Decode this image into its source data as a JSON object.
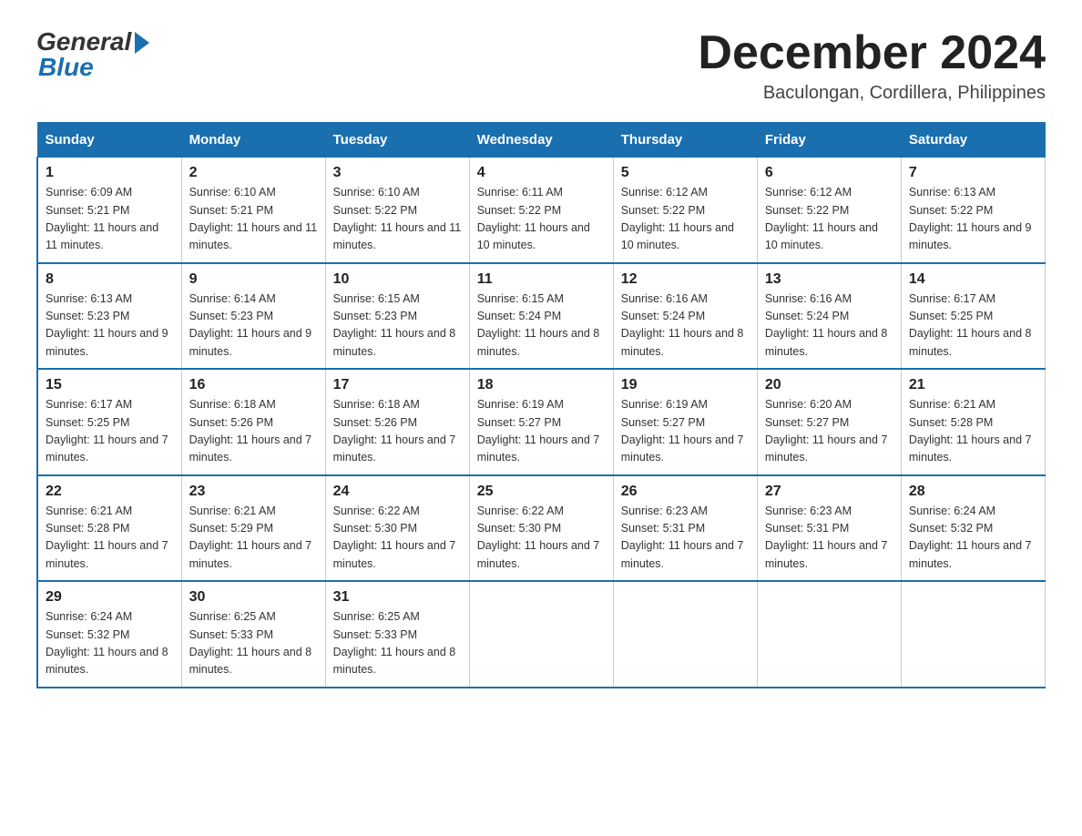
{
  "logo": {
    "general": "General",
    "blue": "Blue"
  },
  "title": "December 2024",
  "subtitle": "Baculongan, Cordillera, Philippines",
  "days_header": [
    "Sunday",
    "Monday",
    "Tuesday",
    "Wednesday",
    "Thursday",
    "Friday",
    "Saturday"
  ],
  "weeks": [
    [
      {
        "num": "1",
        "sunrise": "6:09 AM",
        "sunset": "5:21 PM",
        "daylight": "11 hours and 11 minutes."
      },
      {
        "num": "2",
        "sunrise": "6:10 AM",
        "sunset": "5:21 PM",
        "daylight": "11 hours and 11 minutes."
      },
      {
        "num": "3",
        "sunrise": "6:10 AM",
        "sunset": "5:22 PM",
        "daylight": "11 hours and 11 minutes."
      },
      {
        "num": "4",
        "sunrise": "6:11 AM",
        "sunset": "5:22 PM",
        "daylight": "11 hours and 10 minutes."
      },
      {
        "num": "5",
        "sunrise": "6:12 AM",
        "sunset": "5:22 PM",
        "daylight": "11 hours and 10 minutes."
      },
      {
        "num": "6",
        "sunrise": "6:12 AM",
        "sunset": "5:22 PM",
        "daylight": "11 hours and 10 minutes."
      },
      {
        "num": "7",
        "sunrise": "6:13 AM",
        "sunset": "5:22 PM",
        "daylight": "11 hours and 9 minutes."
      }
    ],
    [
      {
        "num": "8",
        "sunrise": "6:13 AM",
        "sunset": "5:23 PM",
        "daylight": "11 hours and 9 minutes."
      },
      {
        "num": "9",
        "sunrise": "6:14 AM",
        "sunset": "5:23 PM",
        "daylight": "11 hours and 9 minutes."
      },
      {
        "num": "10",
        "sunrise": "6:15 AM",
        "sunset": "5:23 PM",
        "daylight": "11 hours and 8 minutes."
      },
      {
        "num": "11",
        "sunrise": "6:15 AM",
        "sunset": "5:24 PM",
        "daylight": "11 hours and 8 minutes."
      },
      {
        "num": "12",
        "sunrise": "6:16 AM",
        "sunset": "5:24 PM",
        "daylight": "11 hours and 8 minutes."
      },
      {
        "num": "13",
        "sunrise": "6:16 AM",
        "sunset": "5:24 PM",
        "daylight": "11 hours and 8 minutes."
      },
      {
        "num": "14",
        "sunrise": "6:17 AM",
        "sunset": "5:25 PM",
        "daylight": "11 hours and 8 minutes."
      }
    ],
    [
      {
        "num": "15",
        "sunrise": "6:17 AM",
        "sunset": "5:25 PM",
        "daylight": "11 hours and 7 minutes."
      },
      {
        "num": "16",
        "sunrise": "6:18 AM",
        "sunset": "5:26 PM",
        "daylight": "11 hours and 7 minutes."
      },
      {
        "num": "17",
        "sunrise": "6:18 AM",
        "sunset": "5:26 PM",
        "daylight": "11 hours and 7 minutes."
      },
      {
        "num": "18",
        "sunrise": "6:19 AM",
        "sunset": "5:27 PM",
        "daylight": "11 hours and 7 minutes."
      },
      {
        "num": "19",
        "sunrise": "6:19 AM",
        "sunset": "5:27 PM",
        "daylight": "11 hours and 7 minutes."
      },
      {
        "num": "20",
        "sunrise": "6:20 AM",
        "sunset": "5:27 PM",
        "daylight": "11 hours and 7 minutes."
      },
      {
        "num": "21",
        "sunrise": "6:21 AM",
        "sunset": "5:28 PM",
        "daylight": "11 hours and 7 minutes."
      }
    ],
    [
      {
        "num": "22",
        "sunrise": "6:21 AM",
        "sunset": "5:28 PM",
        "daylight": "11 hours and 7 minutes."
      },
      {
        "num": "23",
        "sunrise": "6:21 AM",
        "sunset": "5:29 PM",
        "daylight": "11 hours and 7 minutes."
      },
      {
        "num": "24",
        "sunrise": "6:22 AM",
        "sunset": "5:30 PM",
        "daylight": "11 hours and 7 minutes."
      },
      {
        "num": "25",
        "sunrise": "6:22 AM",
        "sunset": "5:30 PM",
        "daylight": "11 hours and 7 minutes."
      },
      {
        "num": "26",
        "sunrise": "6:23 AM",
        "sunset": "5:31 PM",
        "daylight": "11 hours and 7 minutes."
      },
      {
        "num": "27",
        "sunrise": "6:23 AM",
        "sunset": "5:31 PM",
        "daylight": "11 hours and 7 minutes."
      },
      {
        "num": "28",
        "sunrise": "6:24 AM",
        "sunset": "5:32 PM",
        "daylight": "11 hours and 7 minutes."
      }
    ],
    [
      {
        "num": "29",
        "sunrise": "6:24 AM",
        "sunset": "5:32 PM",
        "daylight": "11 hours and 8 minutes."
      },
      {
        "num": "30",
        "sunrise": "6:25 AM",
        "sunset": "5:33 PM",
        "daylight": "11 hours and 8 minutes."
      },
      {
        "num": "31",
        "sunrise": "6:25 AM",
        "sunset": "5:33 PM",
        "daylight": "11 hours and 8 minutes."
      },
      null,
      null,
      null,
      null
    ]
  ]
}
